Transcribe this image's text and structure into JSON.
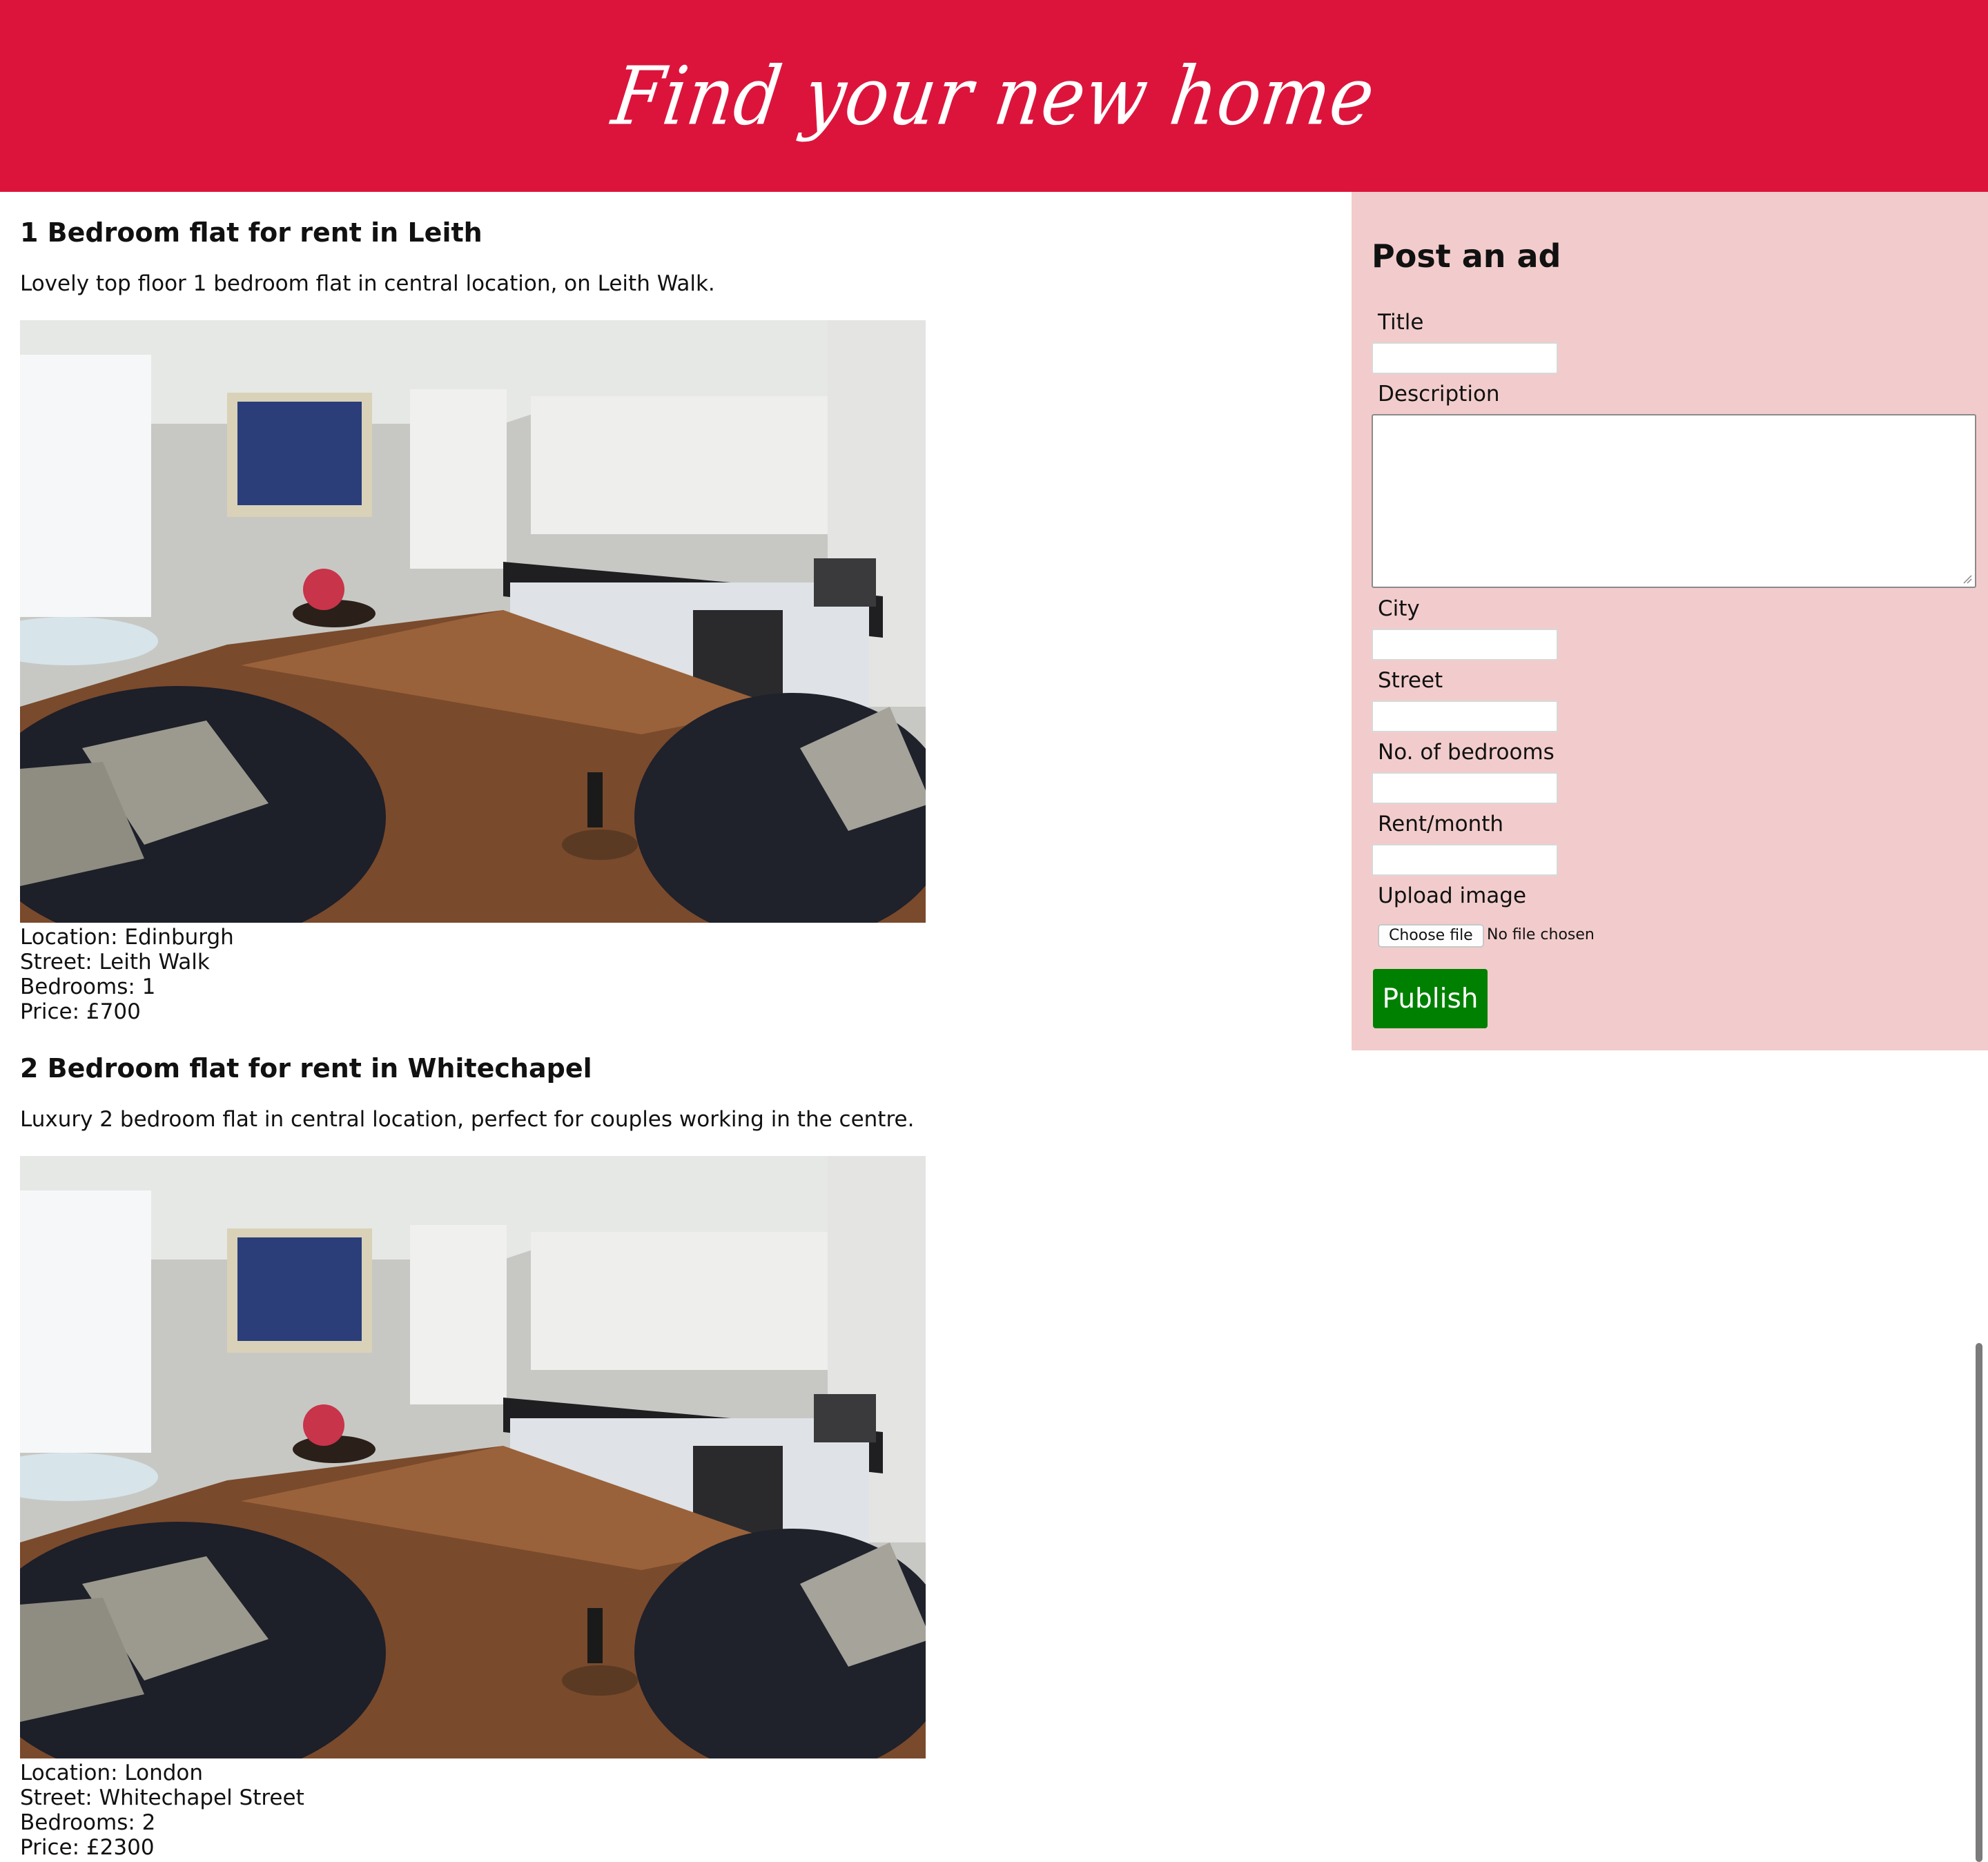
{
  "header": {
    "title": "Find your new home"
  },
  "listings": [
    {
      "title": "1 Bedroom flat for rent in Leith",
      "description": "Lovely top floor 1 bedroom flat in central location, on Leith Walk.",
      "location": "Location: Edinburgh",
      "street": "Street: Leith Walk",
      "bedrooms": "Bedrooms: 1",
      "price": "Price: £700"
    },
    {
      "title": "2 Bedroom flat for rent in Whitechapel",
      "description": "Luxury 2 bedroom flat in central location, perfect for couples working in the centre.",
      "location": "Location: London",
      "street": "Street: Whitechapel Street",
      "bedrooms": "Bedrooms: 2",
      "price": "Price: £2300"
    }
  ],
  "form": {
    "heading": "Post an ad",
    "title_label": "Title",
    "description_label": "Description",
    "city_label": "City",
    "street_label": "Street",
    "bedrooms_label": "No. of bedrooms",
    "rent_label": "Rent/month",
    "upload_label": "Upload image",
    "choose_file": "Choose file",
    "file_status": "No file chosen",
    "publish": "Publish"
  },
  "colors": {
    "header_bg": "#dc143c",
    "sidebar_bg": "#f2cccc",
    "publish_bg": "#008000"
  }
}
